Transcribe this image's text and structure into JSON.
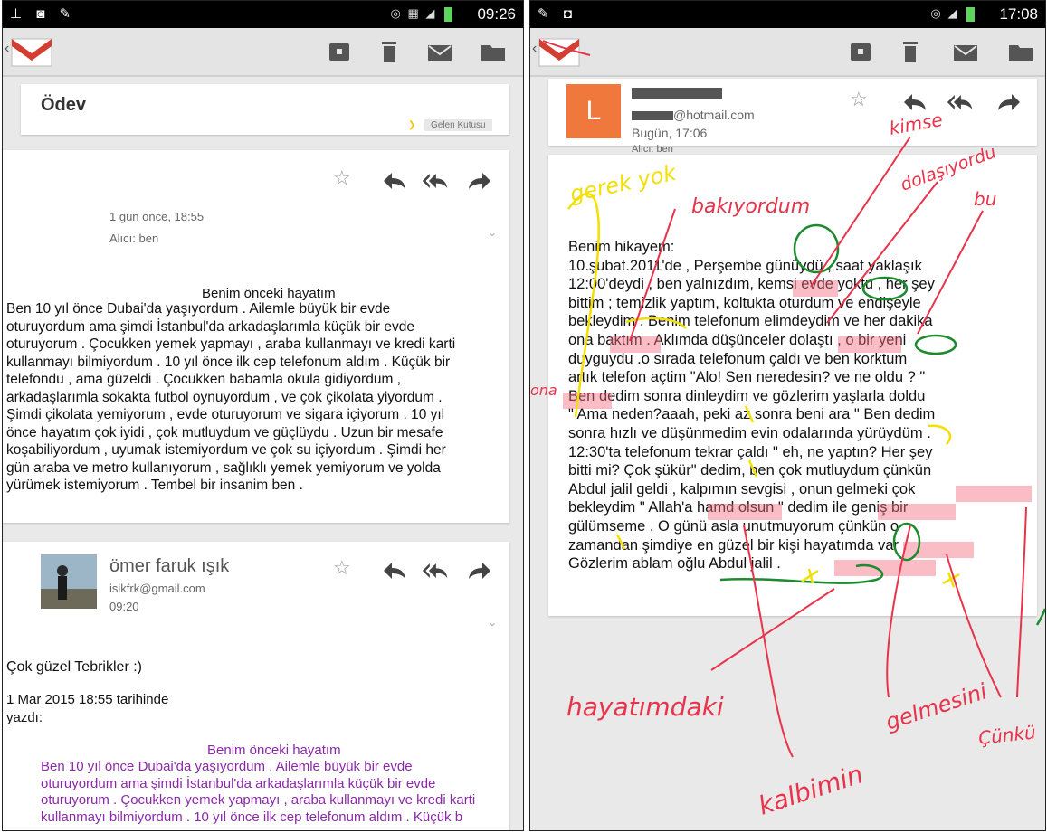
{
  "left_phone": {
    "status_time": "09:26",
    "subject": "Ödev",
    "label_badge": "Gelen Kutusu",
    "message1": {
      "date": "1 gün önce, 18:55",
      "to": "Alıcı: ben",
      "title": "Benim önceki hayatım",
      "lines": [
        "Ben 10 yıl önce Dubai'da yaşıyordum . Ailemle büyük bir evde",
        "oturuyordum ama şimdi İstanbul'da arkadaşlarımla küçük bir evde",
        "oturuyorum . Çocukken yemek yapmayı , araba kullanmayı ve kredi karti",
        "kullanmayı bilmiyordum .  10 yıl önce ilk cep telefonum aldım . Küçük bir",
        "telefondu , ama güzeldi . Çocukken babamla okula gidiyordum ,",
        "arkadaşlarımla sokakta futbol oynuyordum , ve çok çikolata yiyordum .",
        "Şimdi çikolata yemiyorum , evde oturuyorum ve sigara içiyorum . 10 yıl",
        "önce hayatım çok iyidi , çok mutluydum ve güçlüydu . Uzun bir mesafe",
        "koşabiliyordum , uyumak istemiyordum ve çok su içiyordum . Şimdi her",
        "gün araba ve metro kullanıyorum , sağlıklı yemek yemiyorum ve yolda",
        "yürümek istemiyorum . Tembel bir insanim ben ."
      ]
    },
    "message2": {
      "sender_name": "ömer faruk ışık",
      "sender_email": "isikfrk@gmail.com",
      "time": "09:20",
      "reply": "Çok güzel Tebrikler :)",
      "quote_header_1": "1 Mar 2015 18:55 tarihinde",
      "quote_header_2": "yazdı:",
      "quote_title": "Benim önceki hayatım",
      "quote_lines": [
        "Ben 10 yıl önce Dubai'da yaşıyordum . Ailemle büyük bir evde",
        "oturuyordum ama şimdi İstanbul'da arkadaşlarımla küçük bir evde",
        "oturuyorum . Çocukken yemek yapmayı , araba kullanmayı ve kredi karti",
        "kullanmayı bilmiyordum .  10 yıl önce ilk cep telefonum aldım . Küçük b"
      ]
    }
  },
  "right_phone": {
    "status_time": "17:08",
    "avatar_letter": "L",
    "sender_email": "@hotmail.com",
    "date": "Bugün, 17:06",
    "to": "Alıcı: ben",
    "body_lines": [
      "Benim hikayem:",
      "10.şubat.2011'de , Perşembe günüydü , saat yaklaşık",
      "12:00'deydi , ben yalnızdım, kemsi evde yoktu , her şey",
      "bittim ; temizlik yaptım, koltukta oturdum ve endişeyle",
      "bekleydim . Benim telefonum elimdeydim ve her dakika",
      "ona baktım . Aklımda düşünceler dolaştı , o bir yeni",
      "duyguydu .o sırada telefonum çaldı ve ben korktum",
      "artık telefon açtim \"Alo! Sen neredesin? ve ne oldu ? \"",
      "Ben dedim sonra  dinleydim ve gözlerim yaşlarla doldu",
      "\" Ama neden?aaah, peki az sonra beni ara \" Ben dedim",
      "sonra hızlı ve düşünmedim evin odalarında yürüydüm .",
      "12:30'ta telefonum tekrar çaldı \" eh, ne yaptın? Her şey",
      "bitti mi? Çok şükür\" dedim, ben çok mutluydum çünkün",
      "Abdul jalil geldi , kalpımın sevgisi , onun gelmeki çok",
      "bekleydim \" Allah'a hamd olsun \" dedim ile geniş bir",
      "gülümseme . O günü asla unutmuyorum çünkün o",
      "zamandan şimdiye en güzel bir kişi hayatımda var .",
      "Gözlerim ablam oğlu Abdul jalil ."
    ],
    "annotations": {
      "gerek_yok": "gerek yok",
      "bakiyordum": "bakıyordum",
      "kimse": "kimse",
      "dolasiyordu": "dolaşıyordu",
      "bu": "bu",
      "ona": "ona",
      "hayatimdaki": "hayatımdaki",
      "kalbimin": "kalbimin",
      "gelmesini": "gelmesini",
      "cunku": "Çünkü"
    }
  },
  "colors": {
    "gmail_red": "#d23f31",
    "highlight_red": "#f7a6b1",
    "quote_purple": "#8a2aa7",
    "ink_red": "#e8334a",
    "ink_yellow": "#f3e000",
    "ink_green": "#1e8a2e",
    "avatar_orange": "#f0783c"
  }
}
